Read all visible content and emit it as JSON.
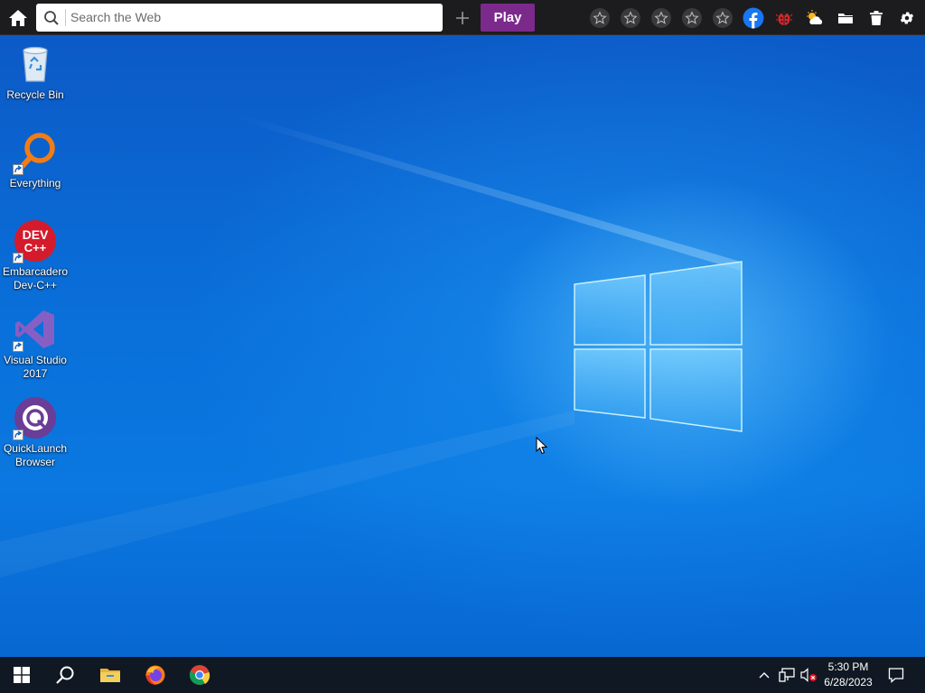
{
  "toolbar": {
    "search": {
      "placeholder": "Search the Web"
    },
    "play_label": "Play",
    "icons": [
      "home-icon",
      "search-icon",
      "plus-icon",
      "star-icon",
      "star-icon",
      "star-icon",
      "star-icon",
      "star-icon",
      "facebook-icon",
      "ladybug-icon",
      "weather-icon",
      "folder-icon",
      "trash-icon",
      "gear-icon"
    ],
    "colors": {
      "bar": "#1c1c1e",
      "play": "#7b2a8c",
      "facebook": "#1877f2"
    }
  },
  "desktop": {
    "icons": [
      {
        "label": "Recycle Bin",
        "icon": "recycle-bin-icon"
      },
      {
        "label": "Everything",
        "icon": "everything-search-icon"
      },
      {
        "label": "Embarcadero Dev-C++",
        "icon": "devcpp-icon"
      },
      {
        "label": "Visual Studio 2017",
        "icon": "visual-studio-icon"
      },
      {
        "label": "QuickLaunch Browser",
        "icon": "quicklaunch-icon"
      }
    ],
    "devcpp_logo_text": "DEV C++",
    "wallpaper_colors": {
      "base": "#0a6ad6",
      "glow": "#78d2ff"
    }
  },
  "taskbar": {
    "pinned": [
      "start-icon",
      "search-icon",
      "file-explorer-icon",
      "firefox-icon",
      "chrome-icon"
    ],
    "tray": [
      "chevron-up-icon",
      "network-icon",
      "volume-muted-icon",
      "notification-icon"
    ],
    "time": "5:30 PM",
    "date": "6/28/2023",
    "color": "#101923"
  }
}
